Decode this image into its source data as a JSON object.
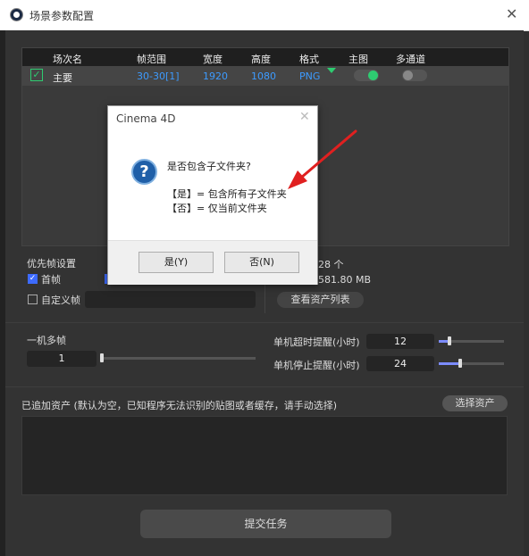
{
  "window": {
    "title": "场景参数配置",
    "close": "✕"
  },
  "table": {
    "headers": [
      "场次名",
      "帧范围",
      "宽度",
      "高度",
      "格式",
      "主图",
      "多通道"
    ],
    "row": {
      "name": "主要",
      "frames": "30-30[1]",
      "width": "1920",
      "height": "1080",
      "format": "PNG",
      "main_on": true,
      "multi_on": false
    }
  },
  "priority": {
    "title": "优先帧设置",
    "first_frame": "首帧",
    "custom_frame": "自定义帧",
    "count_text": "28 个",
    "size_text": "581.80 MB",
    "view_assets": "查看资产列表"
  },
  "multi": {
    "label": "一机多帧",
    "value": "1",
    "timeout_label": "单机超时提醒(小时)",
    "timeout_value": "12",
    "stop_label": "单机停止提醒(小时)",
    "stop_value": "24"
  },
  "assets": {
    "label": "已追加资产 (默认为空，已知程序无法识别的贴图或者缓存，请手动选择)",
    "select_button": "选择资产"
  },
  "submit_label": "提交任务",
  "dialog": {
    "title": "Cinema 4D",
    "question": "是否包含子文件夹?",
    "line_yes": "【是】= 包含所有子文件夹",
    "line_no": "【否】= 仅当前文件夹",
    "yes_button": "是(Y)",
    "no_button": "否(N)"
  },
  "colors": {
    "accent_green": "#2ecc71",
    "accent_blue": "#3d9bff",
    "annotation_red": "#e02020"
  }
}
